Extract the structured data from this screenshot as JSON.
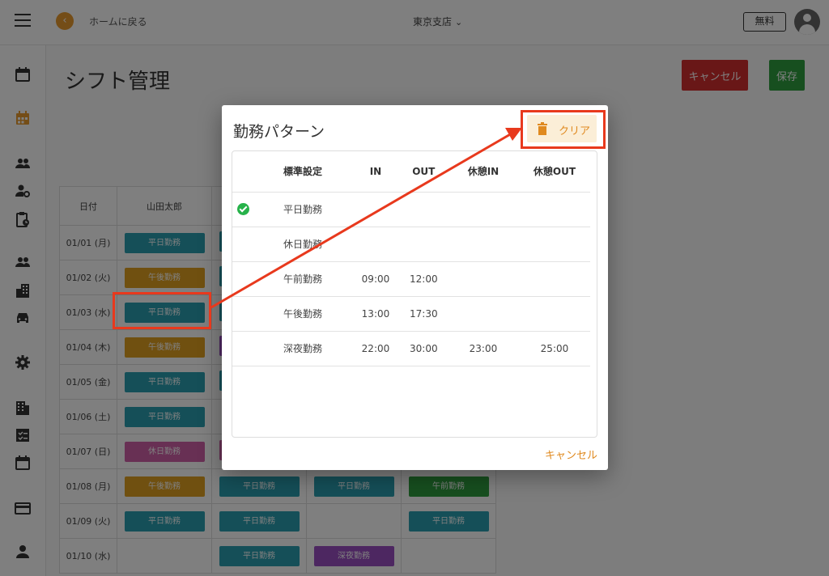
{
  "header": {
    "back_label": "ホームに戻る",
    "branch": "東京支店",
    "plan_label": "無料"
  },
  "page": {
    "title": "シフト管理",
    "cancel_label": "キャンセル",
    "save_label": "保存"
  },
  "shift_table": {
    "headers": [
      "日付",
      "山田太郎"
    ],
    "rows": [
      {
        "date": "01/01 (月)",
        "cells": [
          {
            "label": "平日勤務",
            "kind": "weekday"
          },
          {
            "label": "",
            "kind": "weekday"
          },
          {
            "label": "",
            "kind": "none"
          },
          {
            "label": "",
            "kind": "none"
          }
        ]
      },
      {
        "date": "01/02 (火)",
        "cells": [
          {
            "label": "午後勤務",
            "kind": "afternoon"
          },
          {
            "label": "",
            "kind": "weekday"
          },
          {
            "label": "",
            "kind": "none"
          },
          {
            "label": "",
            "kind": "none"
          }
        ]
      },
      {
        "date": "01/03 (水)",
        "cells": [
          {
            "label": "平日勤務",
            "kind": "weekday"
          },
          {
            "label": "",
            "kind": "weekday"
          },
          {
            "label": "",
            "kind": "none"
          },
          {
            "label": "",
            "kind": "none"
          }
        ]
      },
      {
        "date": "01/04 (木)",
        "cells": [
          {
            "label": "午後勤務",
            "kind": "afternoon"
          },
          {
            "label": "",
            "kind": "night"
          },
          {
            "label": "",
            "kind": "none"
          },
          {
            "label": "",
            "kind": "none"
          }
        ]
      },
      {
        "date": "01/05 (金)",
        "cells": [
          {
            "label": "平日勤務",
            "kind": "weekday"
          },
          {
            "label": "",
            "kind": "weekday"
          },
          {
            "label": "",
            "kind": "none"
          },
          {
            "label": "",
            "kind": "none"
          }
        ]
      },
      {
        "date": "01/06 (土)",
        "cells": [
          {
            "label": "平日勤務",
            "kind": "weekday"
          },
          {
            "label": "",
            "kind": "none"
          },
          {
            "label": "",
            "kind": "none"
          },
          {
            "label": "",
            "kind": "none"
          }
        ]
      },
      {
        "date": "01/07 (日)",
        "cells": [
          {
            "label": "休日勤務",
            "kind": "holiday"
          },
          {
            "label": "",
            "kind": "holiday"
          },
          {
            "label": "",
            "kind": "none"
          },
          {
            "label": "",
            "kind": "none"
          }
        ]
      },
      {
        "date": "01/08 (月)",
        "cells": [
          {
            "label": "午後勤務",
            "kind": "afternoon"
          },
          {
            "label": "平日勤務",
            "kind": "weekday"
          },
          {
            "label": "平日勤務",
            "kind": "weekday"
          },
          {
            "label": "午前勤務",
            "kind": "morning"
          }
        ]
      },
      {
        "date": "01/09 (火)",
        "cells": [
          {
            "label": "平日勤務",
            "kind": "weekday"
          },
          {
            "label": "平日勤務",
            "kind": "weekday"
          },
          {
            "label": "",
            "kind": "none"
          },
          {
            "label": "平日勤務",
            "kind": "weekday"
          }
        ]
      },
      {
        "date": "01/10 (水)",
        "cells": [
          {
            "label": "",
            "kind": "none"
          },
          {
            "label": "平日勤務",
            "kind": "weekday"
          },
          {
            "label": "深夜勤務",
            "kind": "night"
          },
          {
            "label": "",
            "kind": "none"
          }
        ]
      }
    ]
  },
  "dialog": {
    "title": "勤務パターン",
    "clear_label": "クリア",
    "cancel_label": "キャンセル",
    "columns": [
      "",
      "標準設定",
      "IN",
      "OUT",
      "休憩IN",
      "休憩OUT"
    ],
    "rows": [
      {
        "default": true,
        "name": "平日勤務",
        "in": "",
        "out": "",
        "break_in": "",
        "break_out": ""
      },
      {
        "default": false,
        "name": "休日勤務",
        "in": "",
        "out": "",
        "break_in": "",
        "break_out": ""
      },
      {
        "default": false,
        "name": "午前勤務",
        "in": "09:00",
        "out": "12:00",
        "break_in": "",
        "break_out": ""
      },
      {
        "default": false,
        "name": "午後勤務",
        "in": "13:00",
        "out": "17:30",
        "break_in": "",
        "break_out": ""
      },
      {
        "default": false,
        "name": "深夜勤務",
        "in": "22:00",
        "out": "30:00",
        "break_in": "23:00",
        "break_out": "25:00"
      }
    ]
  },
  "colors": {
    "accent": "#e08a20",
    "annotation": "#e8391d",
    "weekday": "#2a9fb0",
    "afternoon": "#e0a020",
    "holiday": "#d060a8",
    "morning": "#2e9e3e",
    "night": "#9a4fc2",
    "danger": "#d32f2f",
    "success": "#2e9e3e"
  },
  "icons": {
    "sidebar": [
      "calendar-icon",
      "calendar-grid-icon",
      "people-icon",
      "person-gear-icon",
      "clipboard-clock-icon",
      "group-icon",
      "building-icon",
      "car-icon",
      "settings-icon",
      "office-icon",
      "checklist-icon",
      "calendar-blank-icon",
      "credit-card-icon",
      "person-icon"
    ]
  }
}
